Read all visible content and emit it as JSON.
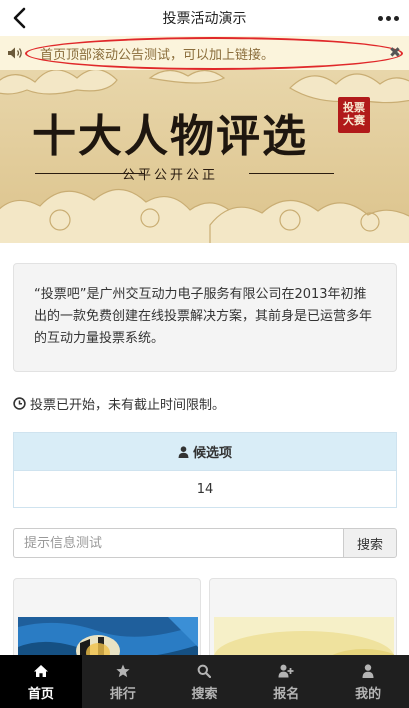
{
  "header": {
    "title": "投票活动演示",
    "back_icon": "chevron-left-icon",
    "more_icon": "more-dots-icon"
  },
  "notice": {
    "icon": "speaker-icon",
    "text": "首页顶部滚动公告测试，可以加上链接。",
    "close_label": "✖",
    "highlight_color": "#e0282a",
    "background": "#fbf4dc"
  },
  "banner": {
    "title": "十大人物评选",
    "subtitle": "公平公开公正",
    "seal_text": "投票大赛",
    "seal_color": "#b11a1a"
  },
  "intro": {
    "text": "“投票吧”是广州交互动力电子服务有限公司在2013年初推出的一款免费创建在线投票解决方案，其前身是已运营多年的互动力量投票系统。"
  },
  "status": {
    "icon": "clock-icon",
    "text": "投票已开始，未有截止时间限制。"
  },
  "candidates": {
    "icon": "user-icon",
    "header": "候选项",
    "count": "14"
  },
  "search": {
    "placeholder": "提示信息测试",
    "value": "",
    "button_label": "搜索"
  },
  "tabbar": {
    "items": [
      {
        "label": "首页",
        "icon": "home-icon",
        "active": true
      },
      {
        "label": "排行",
        "icon": "star-icon",
        "active": false
      },
      {
        "label": "搜索",
        "icon": "search-icon",
        "active": false
      },
      {
        "label": "报名",
        "icon": "add-user-icon",
        "active": false
      },
      {
        "label": "我的",
        "icon": "user-icon",
        "active": false
      }
    ]
  },
  "colors": {
    "accent": "#d9edf7",
    "tabbar_bg": "#1f1f1f",
    "tab_active_bg": "#000000"
  }
}
